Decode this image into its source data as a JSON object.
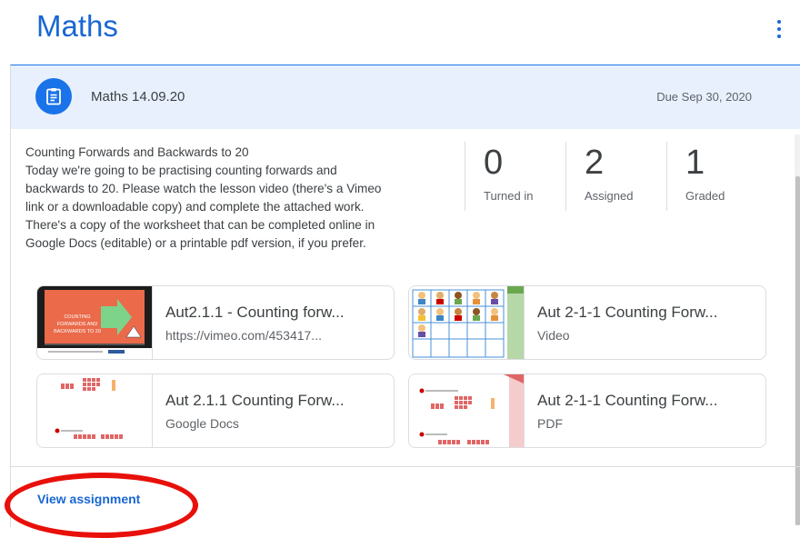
{
  "page": {
    "title": "Maths"
  },
  "assignment": {
    "title": "Maths 14.09.20",
    "due": "Due Sep 30, 2020",
    "description_lines": [
      "Counting Forwards and Backwards to 20",
      "Today we're going to be practising counting forwards and",
      "backwards to 20. Please watch the lesson video (there's a Vimeo",
      "link or a downloadable copy) and complete the attached work.",
      "There's a copy of the worksheet that can be completed online in",
      "Google Docs (editable) or a printable pdf version, if you prefer."
    ]
  },
  "stats": [
    {
      "value": "0",
      "label": "Turned in"
    },
    {
      "value": "2",
      "label": "Assigned"
    },
    {
      "value": "1",
      "label": "Graded"
    }
  ],
  "attachments": [
    {
      "title": "Aut2.1.1 - Counting forw...",
      "subtitle": "https://vimeo.com/453417...",
      "thumb": "video-slide",
      "thumb_text": "COUNTING FORWARDS AND BACKWARDS TO 20"
    },
    {
      "title": "Aut 2-1-1 Counting Forw...",
      "subtitle": "Video",
      "thumb": "children-grid"
    },
    {
      "title": "Aut 2.1.1 Counting Forw...",
      "subtitle": "Google Docs",
      "thumb": "worksheet"
    },
    {
      "title": "Aut 2-1-1 Counting Forw...",
      "subtitle": "PDF",
      "thumb": "worksheet-pdf"
    }
  ],
  "footer": {
    "view_label": "View assignment"
  },
  "colors": {
    "accent": "#1967d2",
    "header_bg": "#e8f0fe",
    "icon_bg": "#1a73e8",
    "highlight": "#e8100a"
  }
}
